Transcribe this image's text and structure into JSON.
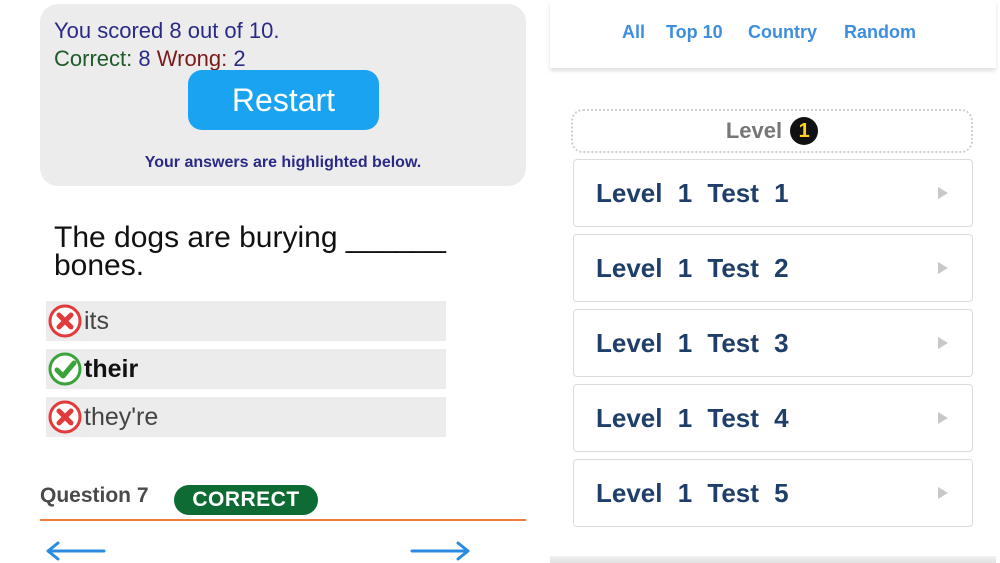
{
  "score": {
    "line": "You scored 8 out of 10.",
    "correct_label": "Correct:",
    "correct_value": "8",
    "wrong_label": "Wrong:",
    "wrong_value": "2",
    "restart_label": "Restart",
    "hint": "Your answers are highlighted below."
  },
  "question": {
    "text": "The dogs are burying ______ bones.",
    "options": [
      {
        "label": "its",
        "status": "wrong"
      },
      {
        "label": "their",
        "status": "correct"
      },
      {
        "label": "they're",
        "status": "wrong"
      }
    ],
    "number_label": "Question 7",
    "result_badge": "CORRECT"
  },
  "tabs": [
    "All",
    "Top 10",
    "Country",
    "Random"
  ],
  "level": {
    "header_label": "Level",
    "number": "1",
    "tests": [
      "Level 1 Test 1",
      "Level 1 Test 2",
      "Level 1 Test 3",
      "Level 1 Test 4",
      "Level 1 Test 5"
    ]
  },
  "icons": {
    "wrong": "x-circle-icon",
    "correct": "check-circle-icon",
    "prev": "arrow-left-icon",
    "next": "arrow-right-icon",
    "chevron": "chevron-right-icon"
  },
  "colors": {
    "accent": "#1aa3f0",
    "badge": "#0f6b34",
    "wrong_icon": "#e23a3a",
    "correct_icon": "#3aa33a",
    "rule": "#f07c3c"
  }
}
